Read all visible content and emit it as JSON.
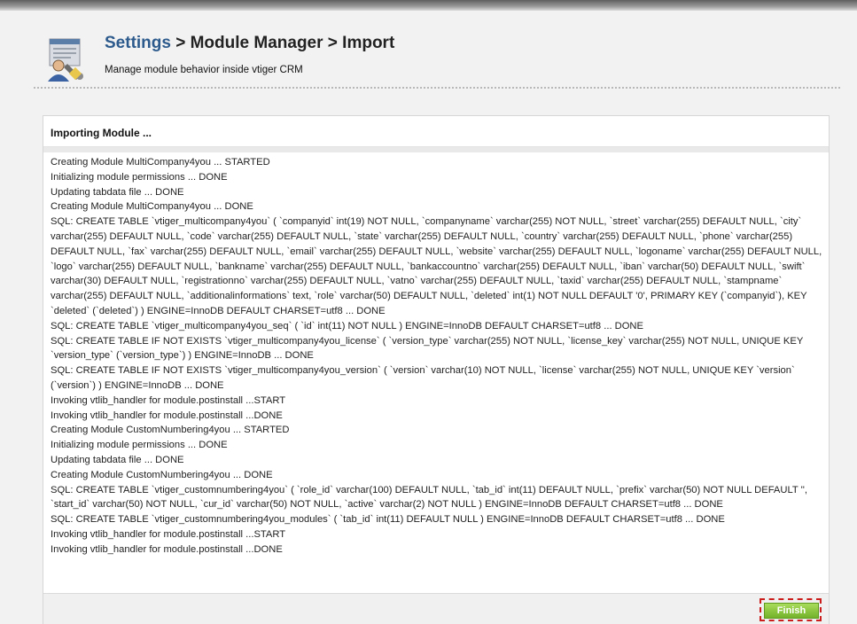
{
  "header": {
    "breadcrumb_link": "Settings",
    "breadcrumb_rest": " > Module Manager > Import",
    "subtitle": "Manage module behavior inside vtiger CRM",
    "icon": "settings-user-icon"
  },
  "panel": {
    "title": "Importing Module ..."
  },
  "log": [
    "Creating Module MultiCompany4you ... STARTED",
    "Initializing module permissions ... DONE",
    "Updating tabdata file ... DONE",
    "Creating Module MultiCompany4you ... DONE",
    "SQL: CREATE TABLE `vtiger_multicompany4you` ( `companyid` int(19) NOT NULL, `companyname` varchar(255) NOT NULL, `street` varchar(255) DEFAULT NULL, `city` varchar(255) DEFAULT NULL, `code` varchar(255) DEFAULT NULL, `state` varchar(255) DEFAULT NULL, `country` varchar(255) DEFAULT NULL, `phone` varchar(255) DEFAULT NULL, `fax` varchar(255) DEFAULT NULL, `email` varchar(255) DEFAULT NULL, `website` varchar(255) DEFAULT NULL, `logoname` varchar(255) DEFAULT NULL, `logo` varchar(255) DEFAULT NULL, `bankname` varchar(255) DEFAULT NULL, `bankaccountno` varchar(255) DEFAULT NULL, `iban` varchar(50) DEFAULT NULL, `swift` varchar(30) DEFAULT NULL, `registrationno` varchar(255) DEFAULT NULL, `vatno` varchar(255) DEFAULT NULL, `taxid` varchar(255) DEFAULT NULL, `stampname` varchar(255) DEFAULT NULL, `additionalinformations` text, `role` varchar(50) DEFAULT NULL, `deleted` int(1) NOT NULL DEFAULT '0', PRIMARY KEY (`companyid`), KEY `deleted` (`deleted`) ) ENGINE=InnoDB DEFAULT CHARSET=utf8 ... DONE",
    "SQL: CREATE TABLE `vtiger_multicompany4you_seq` ( `id` int(11) NOT NULL ) ENGINE=InnoDB DEFAULT CHARSET=utf8 ... DONE",
    "SQL: CREATE TABLE IF NOT EXISTS `vtiger_multicompany4you_license` ( `version_type` varchar(255) NOT NULL, `license_key` varchar(255) NOT NULL, UNIQUE KEY `version_type` (`version_type`) ) ENGINE=InnoDB ... DONE",
    "SQL: CREATE TABLE IF NOT EXISTS `vtiger_multicompany4you_version` ( `version` varchar(10) NOT NULL, `license` varchar(255) NOT NULL, UNIQUE KEY `version` (`version`) ) ENGINE=InnoDB ... DONE",
    "Invoking vtlib_handler for module.postinstall ...START",
    "Invoking vtlib_handler for module.postinstall ...DONE",
    "Creating Module CustomNumbering4you ... STARTED",
    "Initializing module permissions ... DONE",
    "Updating tabdata file ... DONE",
    "Creating Module CustomNumbering4you ... DONE",
    "SQL: CREATE TABLE `vtiger_customnumbering4you` ( `role_id` varchar(100) DEFAULT NULL, `tab_id` int(11) DEFAULT NULL, `prefix` varchar(50) NOT NULL DEFAULT '', `start_id` varchar(50) NOT NULL, `cur_id` varchar(50) NOT NULL, `active` varchar(2) NOT NULL ) ENGINE=InnoDB DEFAULT CHARSET=utf8 ... DONE",
    "SQL: CREATE TABLE `vtiger_customnumbering4you_modules` ( `tab_id` int(11) DEFAULT NULL ) ENGINE=InnoDB DEFAULT CHARSET=utf8 ... DONE",
    "Invoking vtlib_handler for module.postinstall ...START",
    "Invoking vtlib_handler for module.postinstall ...DONE"
  ],
  "footer": {
    "finish_label": "Finish"
  },
  "colors": {
    "link": "#2c5a8c",
    "finish_button": "#8cc63f",
    "highlight_border": "#cc1d1d"
  }
}
